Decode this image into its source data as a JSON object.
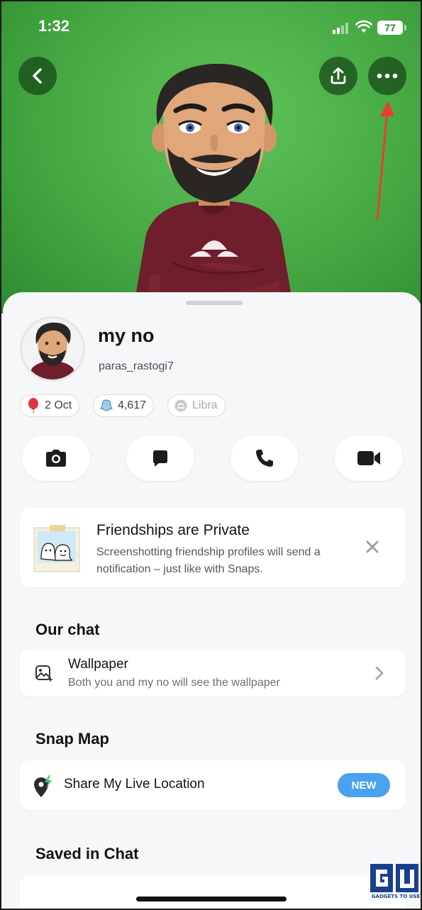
{
  "status_bar": {
    "time": "1:32",
    "battery": "77"
  },
  "profile": {
    "display_name": "my no",
    "username": "paras_rastogi7",
    "chips": {
      "birthday": {
        "icon": "balloon-icon",
        "label": "2 Oct"
      },
      "score": {
        "icon": "ghost-icon",
        "label": "4,617"
      },
      "zodiac": {
        "icon": "zodiac-icon",
        "label": "Libra"
      }
    }
  },
  "actions": [
    "camera-icon",
    "chat-icon",
    "phone-icon",
    "video-icon"
  ],
  "privacy_card": {
    "title": "Friendships are Private",
    "body": "Screenshotting friendship profiles will send a notification – just like with Snaps."
  },
  "our_chat": {
    "title": "Our chat",
    "wallpaper": {
      "title": "Wallpaper",
      "subtitle": "Both you and my no will see the wallpaper"
    }
  },
  "snap_map": {
    "title": "Snap Map",
    "live_location": {
      "title": "Share My Live Location",
      "badge": "NEW"
    }
  },
  "saved_in_chat": {
    "title": "Saved in Chat"
  },
  "watermark": {
    "text": "GADGETS TO USE"
  },
  "colors": {
    "hero_green": "#46a843",
    "accent_blue": "#4aa2ee",
    "hero_button": "#1e4a1e",
    "annotation_arrow": "#e8402f"
  }
}
